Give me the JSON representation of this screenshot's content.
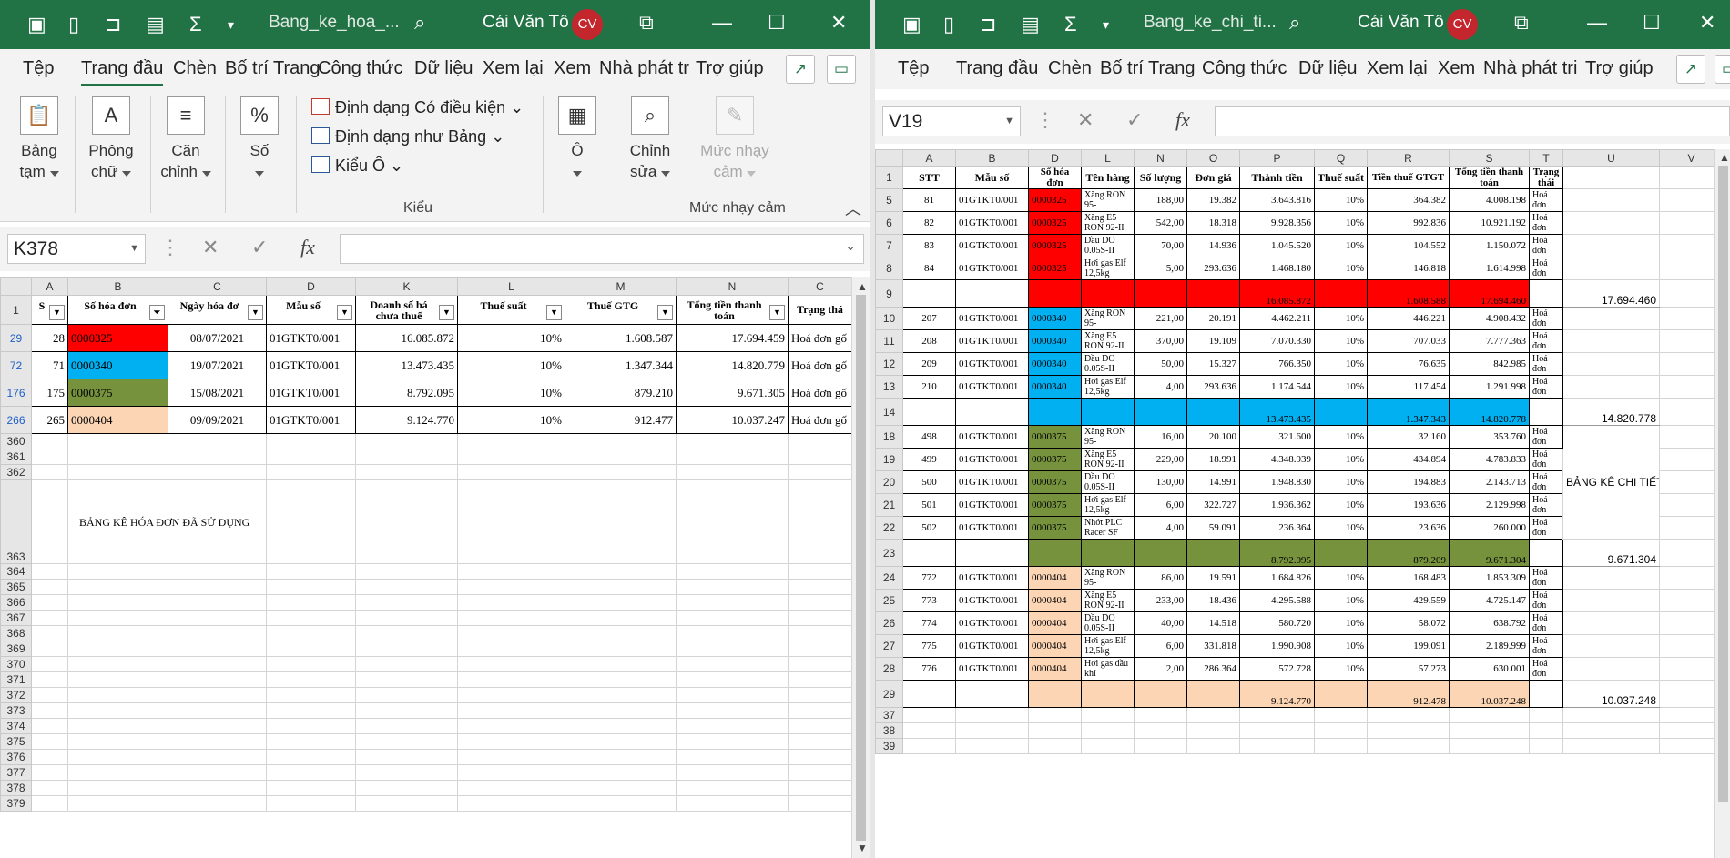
{
  "colors": {
    "accent": "#217346",
    "red": "#ff0000",
    "blue": "#00b0f0",
    "olive": "#76923c",
    "green": "#92d050",
    "peach": "#fcd5b4"
  },
  "left": {
    "title": "Bang_ke_hoa_...",
    "user": "Cái Văn Tô",
    "avatar": "CV",
    "tabs": [
      "Tệp",
      "Trang đầu",
      "Chèn",
      "Bố trí Trang",
      "Công thức",
      "Dữ liệu",
      "Xem lại",
      "Xem",
      "Nhà phát tr",
      "Trợ giúp"
    ],
    "ribbon": {
      "paste": "Bảng tạm",
      "font": "Phông chữ",
      "align": "Căn chỉnh",
      "number": "Số",
      "cond": "Định dạng Có điều kiện",
      "table": "Định dạng như Bảng",
      "cellstyle": "Kiểu Ô",
      "styles_group": "Kiểu",
      "cells": "Ô",
      "edit": "Chỉnh sửa",
      "sens": "Mức nhạy cảm",
      "sens_group": "Mức nhạy cảm"
    },
    "namebox": "K378",
    "fx": "fx",
    "cols": [
      "A",
      "B",
      "C",
      "D",
      "K",
      "L",
      "M",
      "N",
      "C"
    ],
    "headers": [
      "S",
      "Số hóa đơn",
      "Ngày hóa đơ",
      "Mẫu số",
      "Doanh số bá chưa thuế",
      "Thuế suất",
      "Thuế GTG",
      "Tổng tiền thanh toán",
      "Trạng thá"
    ],
    "rows": [
      {
        "rn": "29",
        "a": "28",
        "b": "0000325",
        "c": "08/07/2021",
        "d": "01GTKT0/001",
        "k": "16.085.872",
        "l": "10%",
        "m": "1.608.587",
        "n": "17.694.459",
        "o": "Hoá đơn gố"
      },
      {
        "rn": "72",
        "a": "71",
        "b": "0000340",
        "c": "19/07/2021",
        "d": "01GTKT0/001",
        "k": "13.473.435",
        "l": "10%",
        "m": "1.347.344",
        "n": "14.820.779",
        "o": "Hoá đơn gố"
      },
      {
        "rn": "176",
        "a": "175",
        "b": "0000375",
        "c": "15/08/2021",
        "d": "01GTKT0/001",
        "k": "8.792.095",
        "l": "10%",
        "m": "879.210",
        "n": "9.671.305",
        "o": "Hoá đơn gố"
      },
      {
        "rn": "266",
        "a": "265",
        "b": "0000404",
        "c": "09/09/2021",
        "d": "01GTKT0/001",
        "k": "9.124.770",
        "l": "10%",
        "m": "912.477",
        "n": "10.037.247",
        "o": "Hoá đơn gố"
      }
    ],
    "empty_rows": [
      "360",
      "361",
      "362",
      "363",
      "364",
      "365",
      "366",
      "367",
      "368",
      "369",
      "370",
      "371",
      "372",
      "373",
      "374",
      "375",
      "376",
      "377",
      "378",
      "379"
    ],
    "note": "BẢNG KÊ HÓA ĐƠN ĐÃ SỬ DỤNG"
  },
  "right": {
    "title": "Bang_ke_chi_ti...",
    "user": "Cái Văn Tô",
    "avatar": "CV",
    "tabs": [
      "Tệp",
      "Trang đầu",
      "Chèn",
      "Bố trí Trang",
      "Công thức",
      "Dữ liệu",
      "Xem lại",
      "Xem",
      "Nhà phát tri",
      "Trợ giúp"
    ],
    "namebox": "V19",
    "fx": "fx",
    "cols": [
      "A",
      "B",
      "D",
      "L",
      "N",
      "O",
      "P",
      "Q",
      "R",
      "S",
      "T",
      "U",
      "V"
    ],
    "headers": [
      "STT",
      "Mẫu số",
      "Số hóa đơn",
      "Tên hàng",
      "Số lượng",
      "Đơn giá",
      "Thành tiền",
      "Thuế suất",
      "Tiền thuế GTGT",
      "Tổng tiền thanh toán",
      "Trạng thái"
    ],
    "groups": [
      {
        "color": "red",
        "rows": [
          {
            "rn": "5",
            "stt": "81",
            "mau": "01GTKT0/001",
            "so": "0000325",
            "ten": "Xăng RON 95-",
            "sl": "188,00",
            "dg": "19.382",
            "tt": "3.643.816",
            "ts": "10%",
            "thue": "364.382",
            "tong": "4.008.198",
            "tr": "Hoá đơn"
          },
          {
            "rn": "6",
            "stt": "82",
            "mau": "01GTKT0/001",
            "so": "0000325",
            "ten": "Xăng E5 RON 92-II",
            "sl": "542,00",
            "dg": "18.318",
            "tt": "9.928.356",
            "ts": "10%",
            "thue": "992.836",
            "tong": "10.921.192",
            "tr": "Hoá đơn"
          },
          {
            "rn": "7",
            "stt": "83",
            "mau": "01GTKT0/001",
            "so": "0000325",
            "ten": "Dầu DO 0.05S-II",
            "sl": "70,00",
            "dg": "14.936",
            "tt": "1.045.520",
            "ts": "10%",
            "thue": "104.552",
            "tong": "1.150.072",
            "tr": "Hoá đơn"
          },
          {
            "rn": "8",
            "stt": "84",
            "mau": "01GTKT0/001",
            "so": "0000325",
            "ten": "Hơi gas Elf 12,5kg",
            "sl": "5,00",
            "dg": "293.636",
            "tt": "1.468.180",
            "ts": "10%",
            "thue": "146.818",
            "tong": "1.614.998",
            "tr": "Hoá đơn"
          }
        ],
        "sum": {
          "rn": "9",
          "tt": "16.085.872",
          "thue": "1.608.588",
          "tong": "17.694.460",
          "u": "17.694.460"
        }
      },
      {
        "color": "blue",
        "rows": [
          {
            "rn": "10",
            "stt": "207",
            "mau": "01GTKT0/001",
            "so": "0000340",
            "ten": "Xăng RON 95-",
            "sl": "221,00",
            "dg": "20.191",
            "tt": "4.462.211",
            "ts": "10%",
            "thue": "446.221",
            "tong": "4.908.432",
            "tr": "Hoá đơn"
          },
          {
            "rn": "11",
            "stt": "208",
            "mau": "01GTKT0/001",
            "so": "0000340",
            "ten": "Xăng E5 RON 92-II",
            "sl": "370,00",
            "dg": "19.109",
            "tt": "7.070.330",
            "ts": "10%",
            "thue": "707.033",
            "tong": "7.777.363",
            "tr": "Hoá đơn"
          },
          {
            "rn": "12",
            "stt": "209",
            "mau": "01GTKT0/001",
            "so": "0000340",
            "ten": "Dầu DO 0.05S-II",
            "sl": "50,00",
            "dg": "15.327",
            "tt": "766.350",
            "ts": "10%",
            "thue": "76.635",
            "tong": "842.985",
            "tr": "Hoá đơn"
          },
          {
            "rn": "13",
            "stt": "210",
            "mau": "01GTKT0/001",
            "so": "0000340",
            "ten": "Hơi gas Elf 12,5kg",
            "sl": "4,00",
            "dg": "293.636",
            "tt": "1.174.544",
            "ts": "10%",
            "thue": "117.454",
            "tong": "1.291.998",
            "tr": "Hoá đơn"
          }
        ],
        "sum": {
          "rn": "14",
          "tt": "13.473.435",
          "thue": "1.347.343",
          "tong": "14.820.778",
          "u": "14.820.778"
        }
      },
      {
        "color": "olive",
        "rows": [
          {
            "rn": "18",
            "stt": "498",
            "mau": "01GTKT0/001",
            "so": "0000375",
            "ten": "Xăng RON 95-",
            "sl": "16,00",
            "dg": "20.100",
            "tt": "321.600",
            "ts": "10%",
            "thue": "32.160",
            "tong": "353.760",
            "tr": "Hoá đơn"
          },
          {
            "rn": "19",
            "stt": "499",
            "mau": "01GTKT0/001",
            "so": "0000375",
            "ten": "Xăng E5 RON 92-II",
            "sl": "229,00",
            "dg": "18.991",
            "tt": "4.348.939",
            "ts": "10%",
            "thue": "434.894",
            "tong": "4.783.833",
            "tr": "Hoá đơn"
          },
          {
            "rn": "20",
            "stt": "500",
            "mau": "01GTKT0/001",
            "so": "0000375",
            "ten": "Dầu DO 0.05S-II",
            "sl": "130,00",
            "dg": "14.991",
            "tt": "1.948.830",
            "ts": "10%",
            "thue": "194.883",
            "tong": "2.143.713",
            "tr": "Hoá đơn"
          },
          {
            "rn": "21",
            "stt": "501",
            "mau": "01GTKT0/001",
            "so": "0000375",
            "ten": "Hơi gas Elf 12,5kg",
            "sl": "6,00",
            "dg": "322.727",
            "tt": "1.936.362",
            "ts": "10%",
            "thue": "193.636",
            "tong": "2.129.998",
            "tr": "Hoá đơn"
          },
          {
            "rn": "22",
            "stt": "502",
            "mau": "01GTKT0/001",
            "so": "0000375",
            "ten": "Nhớt PLC Racer SF",
            "sl": "4,00",
            "dg": "59.091",
            "tt": "236.364",
            "ts": "10%",
            "thue": "23.636",
            "tong": "260.000",
            "tr": "Hoá đơn"
          }
        ],
        "sum": {
          "rn": "23",
          "tt": "8.792.095",
          "thue": "879.209",
          "tong": "9.671.304",
          "u": "9.671.304"
        }
      },
      {
        "color": "peach",
        "rows": [
          {
            "rn": "24",
            "stt": "772",
            "mau": "01GTKT0/001",
            "so": "0000404",
            "ten": "Xăng RON 95-",
            "sl": "86,00",
            "dg": "19.591",
            "tt": "1.684.826",
            "ts": "10%",
            "thue": "168.483",
            "tong": "1.853.309",
            "tr": "Hoá đơn"
          },
          {
            "rn": "25",
            "stt": "773",
            "mau": "01GTKT0/001",
            "so": "0000404",
            "ten": "Xăng E5 RON 92-II",
            "sl": "233,00",
            "dg": "18.436",
            "tt": "4.295.588",
            "ts": "10%",
            "thue": "429.559",
            "tong": "4.725.147",
            "tr": "Hoá đơn"
          },
          {
            "rn": "26",
            "stt": "774",
            "mau": "01GTKT0/001",
            "so": "0000404",
            "ten": "Dầu DO 0.05S-II",
            "sl": "40,00",
            "dg": "14.518",
            "tt": "580.720",
            "ts": "10%",
            "thue": "58.072",
            "tong": "638.792",
            "tr": "Hoá đơn"
          },
          {
            "rn": "27",
            "stt": "775",
            "mau": "01GTKT0/001",
            "so": "0000404",
            "ten": "Hơi gas Elf 12,5kg",
            "sl": "6,00",
            "dg": "331.818",
            "tt": "1.990.908",
            "ts": "10%",
            "thue": "199.091",
            "tong": "2.189.999",
            "tr": "Hoá đơn"
          },
          {
            "rn": "28",
            "stt": "776",
            "mau": "01GTKT0/001",
            "so": "0000404",
            "ten": "Hơi gas dầu khí",
            "sl": "2,00",
            "dg": "286.364",
            "tt": "572.728",
            "ts": "10%",
            "thue": "57.273",
            "tong": "630.001",
            "tr": "Hoá đơn"
          }
        ],
        "sum": {
          "rn": "29",
          "tt": "9.124.770",
          "thue": "912.478",
          "tong": "10.037.248",
          "u": "10.037.248"
        }
      }
    ],
    "trailing_rows": [
      "37",
      "38",
      "39"
    ],
    "note": "BẢNG KÊ CHI TIẾT HÓA ĐƠN ĐÃ SỬ DỤNG"
  }
}
